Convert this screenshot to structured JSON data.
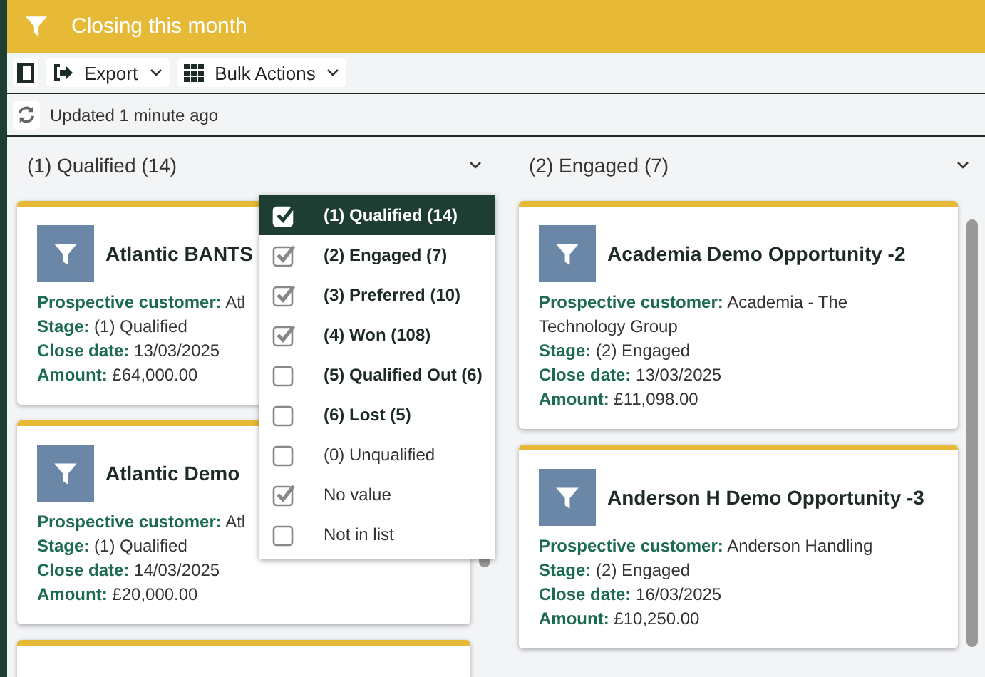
{
  "header": {
    "title": "Closing this month"
  },
  "toolbar": {
    "buttons": [
      {
        "kind": "export",
        "label": "Export"
      },
      {
        "kind": "grid",
        "label": "Bulk Actions"
      }
    ]
  },
  "status": {
    "text": "Updated 1 minute ago"
  },
  "columns": [
    {
      "title": "(1) Qualified (14)",
      "cards": [
        {
          "kind": "full",
          "title": "Atlantic BANTS",
          "fields": [
            {
              "label": "Prospective customer:",
              "value": "Atl"
            },
            {
              "label": "Stage:",
              "value": "(1) Qualified"
            },
            {
              "label": "Close date:",
              "value": "13/03/2025"
            },
            {
              "label": "Amount:",
              "value": "£64,000.00"
            }
          ]
        },
        {
          "kind": "full",
          "title": "Atlantic Demo",
          "fields": [
            {
              "label": "Prospective customer:",
              "value": "Atl"
            },
            {
              "label": "Stage:",
              "value": "(1) Qualified"
            },
            {
              "label": "Close date:",
              "value": "14/03/2025"
            },
            {
              "label": "Amount:",
              "value": "£20,000.00"
            }
          ]
        },
        {
          "kind": "cut"
        }
      ]
    },
    {
      "title": "(2) Engaged (7)",
      "cards": [
        {
          "kind": "full",
          "title": "Academia Demo Opportunity -2",
          "fields": [
            {
              "label": "Prospective customer:",
              "value": "Academia - The Technology Group"
            },
            {
              "label": "Stage:",
              "value": "(2) Engaged"
            },
            {
              "label": "Close date:",
              "value": "13/03/2025"
            },
            {
              "label": "Amount:",
              "value": "£11,098.00"
            }
          ]
        },
        {
          "kind": "full",
          "title": "Anderson H Demo Opportunity -3",
          "fields": [
            {
              "label": "Prospective customer:",
              "value": "Anderson Handling"
            },
            {
              "label": "Stage:",
              "value": "(2) Engaged"
            },
            {
              "label": "Close date:",
              "value": "16/03/2025"
            },
            {
              "label": "Amount:",
              "value": "£10,250.00"
            }
          ]
        }
      ]
    }
  ],
  "filter_menu": {
    "items": [
      {
        "kind": "stage",
        "label": "(1) Qualified (14)",
        "checked": true,
        "selected": true
      },
      {
        "kind": "stage",
        "label": "(2) Engaged (7)",
        "checked": true,
        "selected": false
      },
      {
        "kind": "stage",
        "label": "(3) Preferred (10)",
        "checked": true,
        "selected": false
      },
      {
        "kind": "stage",
        "label": "(4) Won (108)",
        "checked": true,
        "selected": false
      },
      {
        "kind": "stage",
        "label": "(5) Qualified Out (6)",
        "checked": false,
        "selected": false
      },
      {
        "kind": "stage",
        "label": "(6) Lost (5)",
        "checked": false,
        "selected": false
      },
      {
        "kind": "other",
        "label": "(0) Unqualified",
        "checked": false,
        "selected": false
      },
      {
        "kind": "other",
        "label": "No value",
        "checked": true,
        "selected": false
      },
      {
        "kind": "other",
        "label": "Not in list",
        "checked": false,
        "selected": false
      }
    ]
  }
}
